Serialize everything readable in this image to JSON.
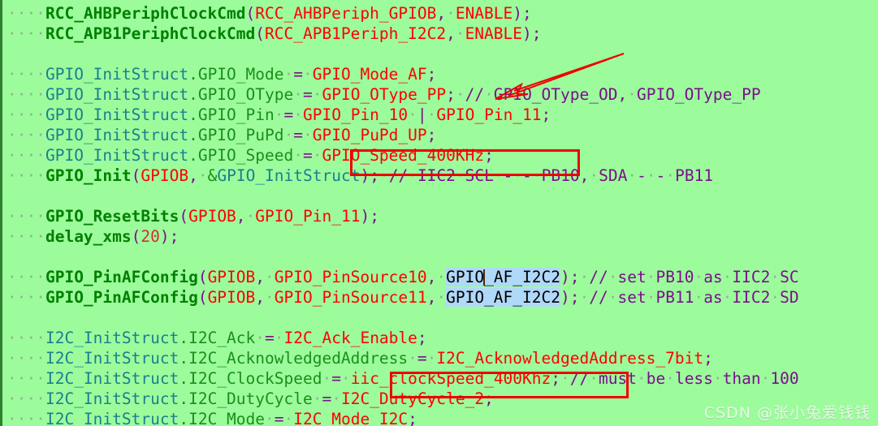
{
  "editor": {
    "background_color": "#9cfc9c",
    "gutter_color": "#2f7f2f",
    "selection_color": "#b0d8f8",
    "annotation_color": "#ee0000",
    "whitespace_dot": "·",
    "indent": "····"
  },
  "lines": [
    {
      "id": "line-1",
      "text": "····RCC_AHBPeriphClockCmd(RCC_AHBPeriph_GPIOB, ENABLE);",
      "tokens": [
        {
          "t": "····",
          "c": "ws"
        },
        {
          "t": "RCC_AHBPeriphClockCmd",
          "c": "fn"
        },
        {
          "t": "(",
          "c": "punc"
        },
        {
          "t": "RCC_AHBPeriph_GPIOB",
          "c": "val"
        },
        {
          "t": ",",
          "c": "punc"
        },
        {
          "t": "·",
          "c": "ws"
        },
        {
          "t": "ENABLE",
          "c": "val"
        },
        {
          "t": ")",
          "c": "punc"
        },
        {
          "t": ";",
          "c": "punc"
        }
      ]
    },
    {
      "id": "line-2",
      "text": "····RCC_APB1PeriphClockCmd(RCC_APB1Periph_I2C2, ENABLE);",
      "tokens": [
        {
          "t": "····",
          "c": "ws"
        },
        {
          "t": "RCC_APB1PeriphClockCmd",
          "c": "fn"
        },
        {
          "t": "(",
          "c": "punc"
        },
        {
          "t": "RCC_APB1Periph_I2C2",
          "c": "val"
        },
        {
          "t": ",",
          "c": "punc"
        },
        {
          "t": "·",
          "c": "ws"
        },
        {
          "t": "ENABLE",
          "c": "val"
        },
        {
          "t": ")",
          "c": "punc"
        },
        {
          "t": ";",
          "c": "punc"
        }
      ]
    },
    {
      "id": "line-3",
      "text": "",
      "tokens": []
    },
    {
      "id": "line-4",
      "text": "····GPIO_InitStruct.GPIO_Mode = GPIO_Mode_AF;",
      "tokens": [
        {
          "t": "····",
          "c": "ws"
        },
        {
          "t": "GPIO_InitStruct",
          "c": "var"
        },
        {
          "t": ".",
          "c": "mem"
        },
        {
          "t": "GPIO_Mode",
          "c": "mem"
        },
        {
          "t": "·",
          "c": "ws"
        },
        {
          "t": "=",
          "c": "op"
        },
        {
          "t": "·",
          "c": "ws"
        },
        {
          "t": "GPIO_Mode_AF",
          "c": "val"
        },
        {
          "t": ";",
          "c": "punc"
        }
      ]
    },
    {
      "id": "line-5",
      "text": "····GPIO_InitStruct.GPIO_OType = GPIO_OType_PP; // GPIO_OType_OD, GPIO_OType_PP",
      "tokens": [
        {
          "t": "····",
          "c": "ws"
        },
        {
          "t": "GPIO_InitStruct",
          "c": "var"
        },
        {
          "t": ".",
          "c": "mem"
        },
        {
          "t": "GPIO_OType",
          "c": "mem"
        },
        {
          "t": "·",
          "c": "ws"
        },
        {
          "t": "=",
          "c": "op"
        },
        {
          "t": "·",
          "c": "ws"
        },
        {
          "t": "GPIO_OType_PP",
          "c": "val"
        },
        {
          "t": ";",
          "c": "punc"
        },
        {
          "t": "·",
          "c": "ws"
        },
        {
          "t": "//",
          "c": "cmt"
        },
        {
          "t": "·",
          "c": "ws"
        },
        {
          "t": "GPIO_OType_OD,",
          "c": "cmt"
        },
        {
          "t": "·",
          "c": "ws"
        },
        {
          "t": "GPIO_OType_PP",
          "c": "cmt"
        }
      ]
    },
    {
      "id": "line-6",
      "text": "····GPIO_InitStruct.GPIO_Pin = GPIO_Pin_10 | GPIO_Pin_11;",
      "tokens": [
        {
          "t": "····",
          "c": "ws"
        },
        {
          "t": "GPIO_InitStruct",
          "c": "var"
        },
        {
          "t": ".",
          "c": "mem"
        },
        {
          "t": "GPIO_Pin",
          "c": "mem"
        },
        {
          "t": "·",
          "c": "ws"
        },
        {
          "t": "=",
          "c": "op"
        },
        {
          "t": "·",
          "c": "ws"
        },
        {
          "t": "GPIO_Pin_10",
          "c": "val"
        },
        {
          "t": "·",
          "c": "ws"
        },
        {
          "t": "|",
          "c": "op"
        },
        {
          "t": "·",
          "c": "ws"
        },
        {
          "t": "GPIO_Pin_11",
          "c": "val"
        },
        {
          "t": ";",
          "c": "punc"
        }
      ]
    },
    {
      "id": "line-7",
      "text": "····GPIO_InitStruct.GPIO_PuPd = GPIO_PuPd_UP;",
      "tokens": [
        {
          "t": "····",
          "c": "ws"
        },
        {
          "t": "GPIO_InitStruct",
          "c": "var"
        },
        {
          "t": ".",
          "c": "mem"
        },
        {
          "t": "GPIO_PuPd",
          "c": "mem"
        },
        {
          "t": "·",
          "c": "ws"
        },
        {
          "t": "=",
          "c": "op"
        },
        {
          "t": "·",
          "c": "ws"
        },
        {
          "t": "GPIO_PuPd_UP",
          "c": "val"
        },
        {
          "t": ";",
          "c": "punc"
        }
      ]
    },
    {
      "id": "line-8",
      "text": "····GPIO_InitStruct.GPIO_Speed = GPIO_Speed_400KHz;",
      "tokens": [
        {
          "t": "····",
          "c": "ws"
        },
        {
          "t": "GPIO_InitStruct",
          "c": "var"
        },
        {
          "t": ".",
          "c": "mem"
        },
        {
          "t": "GPIO_Speed",
          "c": "mem"
        },
        {
          "t": "·",
          "c": "ws"
        },
        {
          "t": "=",
          "c": "op"
        },
        {
          "t": "·",
          "c": "ws"
        },
        {
          "t": "GPIO_Speed_400KHz",
          "c": "val"
        },
        {
          "t": ";",
          "c": "punc"
        }
      ]
    },
    {
      "id": "line-9",
      "text": "····GPIO_Init(GPIOB, &GPIO_InitStruct); // IIC2 SCL - PB10, SDA - PB11",
      "tokens": [
        {
          "t": "····",
          "c": "ws"
        },
        {
          "t": "GPIO_Init",
          "c": "fn"
        },
        {
          "t": "(",
          "c": "punc"
        },
        {
          "t": "GPIOB",
          "c": "val"
        },
        {
          "t": ",",
          "c": "punc"
        },
        {
          "t": "·",
          "c": "ws"
        },
        {
          "t": "&",
          "c": "mem"
        },
        {
          "t": "GPIO_InitStruct",
          "c": "var"
        },
        {
          "t": ")",
          "c": "punc"
        },
        {
          "t": ";",
          "c": "punc"
        },
        {
          "t": "·",
          "c": "ws"
        },
        {
          "t": "//",
          "c": "cmt"
        },
        {
          "t": "·",
          "c": "ws"
        },
        {
          "t": "IIC2",
          "c": "cmt"
        },
        {
          "t": "·",
          "c": "ws"
        },
        {
          "t": "SCL",
          "c": "cmt"
        },
        {
          "t": "·",
          "c": "ws"
        },
        {
          "t": "-",
          "c": "cmt"
        },
        {
          "t": "·",
          "c": "ws"
        },
        {
          "t": "-",
          "c": "cmt"
        },
        {
          "t": "·",
          "c": "ws"
        },
        {
          "t": "PB10,",
          "c": "cmt"
        },
        {
          "t": "·",
          "c": "ws"
        },
        {
          "t": "SDA",
          "c": "cmt"
        },
        {
          "t": "·",
          "c": "ws"
        },
        {
          "t": "-",
          "c": "cmt"
        },
        {
          "t": "·",
          "c": "ws"
        },
        {
          "t": "-",
          "c": "cmt"
        },
        {
          "t": "·",
          "c": "ws"
        },
        {
          "t": "PB11",
          "c": "cmt"
        }
      ]
    },
    {
      "id": "line-10",
      "text": "",
      "tokens": []
    },
    {
      "id": "line-11",
      "text": "····GPIO_ResetBits(GPIOB, GPIO_Pin_11);",
      "tokens": [
        {
          "t": "····",
          "c": "ws"
        },
        {
          "t": "GPIO_ResetBits",
          "c": "fn"
        },
        {
          "t": "(",
          "c": "punc"
        },
        {
          "t": "GPIOB",
          "c": "val"
        },
        {
          "t": ",",
          "c": "punc"
        },
        {
          "t": "·",
          "c": "ws"
        },
        {
          "t": "GPIO_Pin_11",
          "c": "val"
        },
        {
          "t": ")",
          "c": "punc"
        },
        {
          "t": ";",
          "c": "punc"
        }
      ]
    },
    {
      "id": "line-12",
      "text": "····delay_xms(20);",
      "tokens": [
        {
          "t": "····",
          "c": "ws"
        },
        {
          "t": "delay_xms",
          "c": "fn"
        },
        {
          "t": "(",
          "c": "punc"
        },
        {
          "t": "20",
          "c": "num"
        },
        {
          "t": ")",
          "c": "punc"
        },
        {
          "t": ";",
          "c": "punc"
        }
      ]
    },
    {
      "id": "line-13",
      "text": "",
      "tokens": []
    },
    {
      "id": "line-14",
      "text": "····GPIO_PinAFConfig(GPIOB, GPIO_PinSource10, GPIO_AF_I2C2); // set PB10 as IIC2 SC",
      "tokens": [
        {
          "t": "····",
          "c": "ws"
        },
        {
          "t": "GPIO_PinAFConfig",
          "c": "fn"
        },
        {
          "t": "(",
          "c": "punc"
        },
        {
          "t": "GPIOB",
          "c": "val"
        },
        {
          "t": ",",
          "c": "punc"
        },
        {
          "t": "·",
          "c": "ws"
        },
        {
          "t": "GPIO_PinSource10",
          "c": "val"
        },
        {
          "t": ",",
          "c": "punc"
        },
        {
          "t": "·",
          "c": "ws"
        },
        {
          "t": "GPIO_AF_I2C2",
          "c": "sel",
          "caret_after": 4
        },
        {
          "t": ")",
          "c": "punc"
        },
        {
          "t": ";",
          "c": "punc"
        },
        {
          "t": "·",
          "c": "ws"
        },
        {
          "t": "//",
          "c": "cmt"
        },
        {
          "t": "·",
          "c": "ws"
        },
        {
          "t": "set",
          "c": "cmt"
        },
        {
          "t": "·",
          "c": "ws"
        },
        {
          "t": "PB10",
          "c": "cmt"
        },
        {
          "t": "·",
          "c": "ws"
        },
        {
          "t": "as",
          "c": "cmt"
        },
        {
          "t": "·",
          "c": "ws"
        },
        {
          "t": "IIC2",
          "c": "cmt"
        },
        {
          "t": "·",
          "c": "ws"
        },
        {
          "t": "SC",
          "c": "cmt"
        }
      ]
    },
    {
      "id": "line-15",
      "text": "····GPIO_PinAFConfig(GPIOB, GPIO_PinSource11, GPIO_AF_I2C2); // set PB11 as IIC2 SD",
      "tokens": [
        {
          "t": "····",
          "c": "ws"
        },
        {
          "t": "GPIO_PinAFConfig",
          "c": "fn"
        },
        {
          "t": "(",
          "c": "punc"
        },
        {
          "t": "GPIOB",
          "c": "val"
        },
        {
          "t": ",",
          "c": "punc"
        },
        {
          "t": "·",
          "c": "ws"
        },
        {
          "t": "GPIO_PinSource11",
          "c": "val"
        },
        {
          "t": ",",
          "c": "punc"
        },
        {
          "t": "·",
          "c": "ws"
        },
        {
          "t": "GPIO_AF_I2C2",
          "c": "sel"
        },
        {
          "t": ")",
          "c": "punc"
        },
        {
          "t": ";",
          "c": "punc"
        },
        {
          "t": "·",
          "c": "ws"
        },
        {
          "t": "//",
          "c": "cmt"
        },
        {
          "t": "·",
          "c": "ws"
        },
        {
          "t": "set",
          "c": "cmt"
        },
        {
          "t": "·",
          "c": "ws"
        },
        {
          "t": "PB11",
          "c": "cmt"
        },
        {
          "t": "·",
          "c": "ws"
        },
        {
          "t": "as",
          "c": "cmt"
        },
        {
          "t": "·",
          "c": "ws"
        },
        {
          "t": "IIC2",
          "c": "cmt"
        },
        {
          "t": "·",
          "c": "ws"
        },
        {
          "t": "SD",
          "c": "cmt"
        }
      ]
    },
    {
      "id": "line-16",
      "text": "",
      "tokens": []
    },
    {
      "id": "line-17",
      "text": "····I2C_InitStruct.I2C_Ack = I2C_Ack_Enable;",
      "tokens": [
        {
          "t": "····",
          "c": "ws"
        },
        {
          "t": "I2C_InitStruct",
          "c": "var"
        },
        {
          "t": ".",
          "c": "mem"
        },
        {
          "t": "I2C_Ack",
          "c": "mem"
        },
        {
          "t": "·",
          "c": "ws"
        },
        {
          "t": "=",
          "c": "op"
        },
        {
          "t": "·",
          "c": "ws"
        },
        {
          "t": "I2C_Ack_Enable",
          "c": "val"
        },
        {
          "t": ";",
          "c": "punc"
        }
      ]
    },
    {
      "id": "line-18",
      "text": "····I2C_InitStruct.I2C_AcknowledgedAddress = I2C_AcknowledgedAddress_7bit;",
      "tokens": [
        {
          "t": "····",
          "c": "ws"
        },
        {
          "t": "I2C_InitStruct",
          "c": "var"
        },
        {
          "t": ".",
          "c": "mem"
        },
        {
          "t": "I2C_AcknowledgedAddress",
          "c": "mem"
        },
        {
          "t": "·",
          "c": "ws"
        },
        {
          "t": "=",
          "c": "op"
        },
        {
          "t": "·",
          "c": "ws"
        },
        {
          "t": "I2C_AcknowledgedAddress_7bit",
          "c": "val"
        },
        {
          "t": ";",
          "c": "punc"
        }
      ]
    },
    {
      "id": "line-19",
      "text": "····I2C_InitStruct.I2C_ClockSpeed = iic_clockSpeed_400Khz; // must be less than 100",
      "tokens": [
        {
          "t": "····",
          "c": "ws"
        },
        {
          "t": "I2C_InitStruct",
          "c": "var"
        },
        {
          "t": ".",
          "c": "mem"
        },
        {
          "t": "I2C_ClockSpeed",
          "c": "mem"
        },
        {
          "t": "·",
          "c": "ws"
        },
        {
          "t": "=",
          "c": "op"
        },
        {
          "t": "·",
          "c": "ws"
        },
        {
          "t": "iic_clockSpeed_400Khz",
          "c": "val"
        },
        {
          "t": ";",
          "c": "punc"
        },
        {
          "t": "·",
          "c": "ws"
        },
        {
          "t": "//",
          "c": "cmt"
        },
        {
          "t": "·",
          "c": "ws"
        },
        {
          "t": "must",
          "c": "cmt"
        },
        {
          "t": "·",
          "c": "ws"
        },
        {
          "t": "be",
          "c": "cmt"
        },
        {
          "t": "·",
          "c": "ws"
        },
        {
          "t": "less",
          "c": "cmt"
        },
        {
          "t": "·",
          "c": "ws"
        },
        {
          "t": "than",
          "c": "cmt"
        },
        {
          "t": "·",
          "c": "ws"
        },
        {
          "t": "100",
          "c": "cmt"
        }
      ]
    },
    {
      "id": "line-20",
      "text": "····I2C_InitStruct.I2C_DutyCycle = I2C_DutyCycle_2;",
      "tokens": [
        {
          "t": "····",
          "c": "ws"
        },
        {
          "t": "I2C_InitStruct",
          "c": "var"
        },
        {
          "t": ".",
          "c": "mem"
        },
        {
          "t": "I2C_DutyCycle",
          "c": "mem"
        },
        {
          "t": "·",
          "c": "ws"
        },
        {
          "t": "=",
          "c": "op"
        },
        {
          "t": "·",
          "c": "ws"
        },
        {
          "t": "I2C_DutyCycle_2",
          "c": "val"
        },
        {
          "t": ";",
          "c": "punc"
        }
      ]
    },
    {
      "id": "line-21",
      "text": "····I2C_InitStruct.I2C_Mode = I2C_Mode_I2C;",
      "tokens": [
        {
          "t": "····",
          "c": "ws"
        },
        {
          "t": "I2C_InitStruct",
          "c": "var"
        },
        {
          "t": ".",
          "c": "mem"
        },
        {
          "t": "I2C_Mode",
          "c": "mem"
        },
        {
          "t": "·",
          "c": "ws"
        },
        {
          "t": "=",
          "c": "op"
        },
        {
          "t": "·",
          "c": "ws"
        },
        {
          "t": "I2C_Mode_I2C",
          "c": "val"
        },
        {
          "t": ";",
          "c": "punc"
        }
      ]
    }
  ],
  "annotations": {
    "box_gpio_speed": {
      "name": "GPIO_Speed_400KHz;",
      "color": "#ee0000"
    },
    "box_iic_clock": {
      "name": "iic_clockSpeed_400Khz;",
      "color": "#ee0000"
    },
    "arrow": {
      "points_to": "GPIO_OType_PP;",
      "color": "#ee0000"
    }
  },
  "watermark": {
    "text": "CSDN @张小兔爱钱钱"
  }
}
